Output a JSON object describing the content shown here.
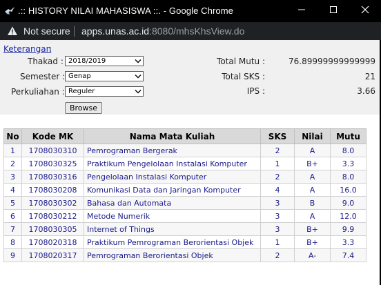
{
  "window": {
    "title": ".:: HISTORY NILAI MAHASISWA ::. - Google Chrome",
    "favicon_icon": "bird-favicon-icon",
    "minimize_icon": "minimize-icon",
    "maximize_icon": "maximize-icon",
    "close_icon": "close-icon"
  },
  "address_bar": {
    "security_label": "Not secure",
    "url_host": "apps.unas.ac.id",
    "url_rest": ":8080/mhsKhsView.do"
  },
  "form": {
    "keterangan_link": "Keterangan",
    "keterangan_colon": ":",
    "thakad_label": "Thakad :",
    "thakad_value": "2018/2019",
    "semester_label": "Semester :",
    "semester_value": "Genap",
    "perkuliahan_label": "Perkuliahan :",
    "perkuliahan_value": "Reguler",
    "browse_label": "Browse"
  },
  "summary": {
    "total_mutu_label": "Total Mutu :",
    "total_mutu_value": "76.89999999999999",
    "total_sks_label": "Total SKS :",
    "total_sks_value": "21",
    "ips_label": "IPS :",
    "ips_value": "3.66"
  },
  "table": {
    "headers": [
      "No",
      "Kode MK",
      "Nama Mata Kuliah",
      "SKS",
      "Nilai",
      "Mutu"
    ],
    "rows": [
      [
        "1",
        "1708030310",
        "Pemrograman Bergerak",
        "2",
        "A",
        "8.0"
      ],
      [
        "2",
        "1708030325",
        "Praktikum Pengelolaan Instalasi Komputer",
        "1",
        "B+",
        "3.3"
      ],
      [
        "3",
        "1708030316",
        "Pengelolaan Instalasi Komputer",
        "2",
        "A",
        "8.0"
      ],
      [
        "4",
        "1708030208",
        "Komunikasi Data dan Jaringan Komputer",
        "4",
        "A",
        "16.0"
      ],
      [
        "5",
        "1708030302",
        "Bahasa dan Automata",
        "3",
        "B",
        "9.0"
      ],
      [
        "6",
        "1708030212",
        "Metode Numerik",
        "3",
        "A",
        "12.0"
      ],
      [
        "7",
        "1708030305",
        "Internet of Things",
        "3",
        "B+",
        "9.9"
      ],
      [
        "8",
        "1708020318",
        "Praktikum Pemrograman Berorientasi Objek",
        "1",
        "B+",
        "3.3"
      ],
      [
        "9",
        "1708020317",
        "Pemrograman Berorientasi Objek",
        "2",
        "A-",
        "7.4"
      ]
    ]
  },
  "colors": {
    "titlebar_bg": "#000000",
    "addressbar_bg": "#202124",
    "table_header_bg": "#d9d9d9",
    "table_text": "#1a1a8a",
    "link": "#1a2aa8"
  }
}
